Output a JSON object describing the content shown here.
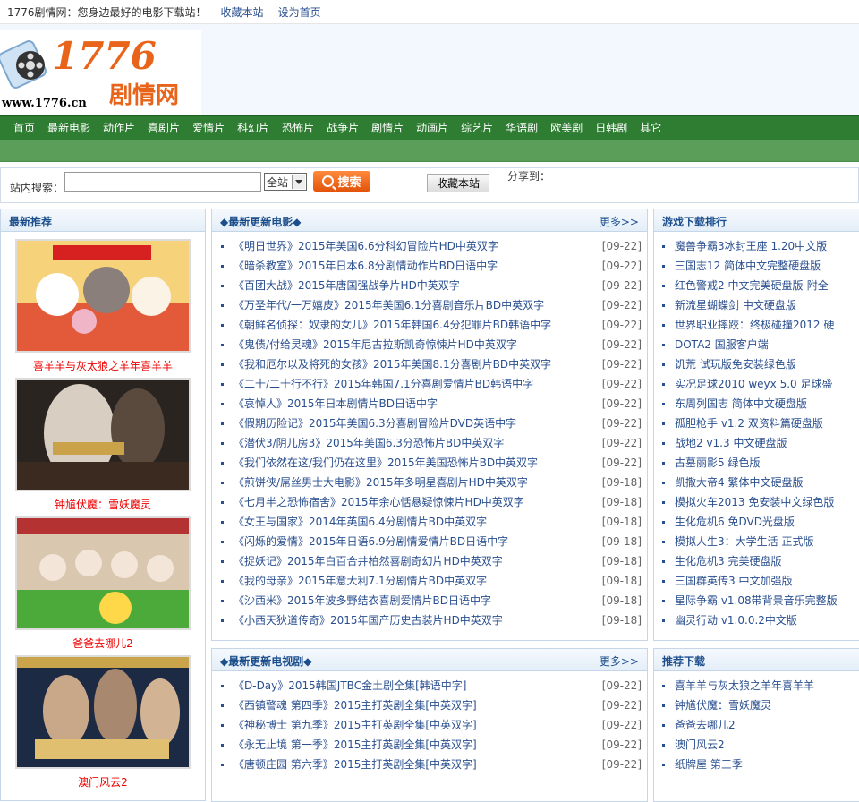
{
  "topbar": {
    "welcome": "1776剧情网：您身边最好的电影下载站！",
    "bookmark": "收藏本站",
    "homepage": "设为首页"
  },
  "logo": {
    "number": "1776",
    "cn": "剧情网",
    "domain": "www.1776.cn"
  },
  "nav": [
    "首页",
    "最新电影",
    "动作片",
    "喜剧片",
    "爱情片",
    "科幻片",
    "恐怖片",
    "战争片",
    "剧情片",
    "动画片",
    "综艺片",
    "华语剧",
    "欧美剧",
    "日韩剧",
    "其它"
  ],
  "search": {
    "label": "站内搜索：",
    "select": "全站",
    "button": "搜索",
    "fav": "收藏本站",
    "share": "分享到："
  },
  "recommend": {
    "title": "最新推荐",
    "items": [
      {
        "caption": "喜羊羊与灰太狼之羊年喜羊羊"
      },
      {
        "caption": "钟馗伏魔：雪妖魔灵"
      },
      {
        "caption": "爸爸去哪儿2"
      },
      {
        "caption": "澳门风云2"
      }
    ]
  },
  "movies": {
    "title": "◆最新更新电影◆",
    "more": "更多>>",
    "items": [
      {
        "t": "《明日世界》2015年美国6.6分科幻冒险片HD中英双字",
        "d": "[09-22]"
      },
      {
        "t": "《暗杀教室》2015年日本6.8分剧情动作片BD日语中字",
        "d": "[09-22]"
      },
      {
        "t": "《百团大战》2015年唐国强战争片HD中英双字",
        "d": "[09-22]"
      },
      {
        "t": "《万圣年代/一万嬉皮》2015年美国6.1分喜剧音乐片BD中英双字",
        "d": "[09-22]"
      },
      {
        "t": "《朝鲜名侦探：奴隶的女儿》2015年韩国6.4分犯罪片BD韩语中字",
        "d": "[09-22]"
      },
      {
        "t": "《鬼债/付给灵魂》2015年尼古拉斯凯奇惊悚片HD中英双字",
        "d": "[09-22]"
      },
      {
        "t": "《我和厄尔以及将死的女孩》2015年美国8.1分喜剧片BD中英双字",
        "d": "[09-22]"
      },
      {
        "t": "《二十/二十行不行》2015年韩国7.1分喜剧爱情片BD韩语中字",
        "d": "[09-22]"
      },
      {
        "t": "《哀悼人》2015年日本剧情片BD日语中字",
        "d": "[09-22]"
      },
      {
        "t": "《假期历险记》2015年美国6.3分喜剧冒险片DVD英语中字",
        "d": "[09-22]"
      },
      {
        "t": "《潜伏3/阴儿房3》2015年美国6.3分恐怖片BD中英双字",
        "d": "[09-22]"
      },
      {
        "t": "《我们依然在这/我们仍在这里》2015年美国恐怖片BD中英双字",
        "d": "[09-22]"
      },
      {
        "t": "《煎饼侠/屌丝男士大电影》2015年多明星喜剧片HD中英双字",
        "d": "[09-18]"
      },
      {
        "t": "《七月半之恐怖宿舍》2015年余心恬悬疑惊悚片HD中英双字",
        "d": "[09-18]"
      },
      {
        "t": "《女王与国家》2014年英国6.4分剧情片BD中英双字",
        "d": "[09-18]"
      },
      {
        "t": "《闪烁的爱情》2015年日语6.9分剧情爱情片BD日语中字",
        "d": "[09-18]"
      },
      {
        "t": "《捉妖记》2015年白百合井柏然喜剧奇幻片HD中英双字",
        "d": "[09-18]"
      },
      {
        "t": "《我的母亲》2015年意大利7.1分剧情片BD中英双字",
        "d": "[09-18]"
      },
      {
        "t": "《沙西米》2015年波多野结衣喜剧爱情片BD日语中字",
        "d": "[09-18]"
      },
      {
        "t": "《小西天狄道传奇》2015年国产历史古装片HD中英双字",
        "d": "[09-18]"
      }
    ]
  },
  "tv": {
    "title": "◆最新更新电视剧◆",
    "more": "更多>>",
    "items": [
      {
        "t": "《D-Day》2015韩国JTBC金土剧全集[韩语中字]",
        "d": "[09-22]"
      },
      {
        "t": "《西镇警魂 第四季》2015主打英剧全集[中英双字]",
        "d": "[09-22]"
      },
      {
        "t": "《神秘博士 第九季》2015主打英剧全集[中英双字]",
        "d": "[09-22]"
      },
      {
        "t": "《永无止境 第一季》2015主打英剧全集[中英双字]",
        "d": "[09-22]"
      },
      {
        "t": "《唐顿庄园 第六季》2015主打英剧全集[中英双字]",
        "d": "[09-22]"
      }
    ]
  },
  "games": {
    "title": "游戏下载排行",
    "items": [
      "魔兽争霸3冰封王座 1.20中文版",
      "三国志12 简体中文完整硬盘版",
      "红色警戒2 中文完美硬盘版-附全",
      "新流星蝴蝶剑 中文硬盘版",
      "世界职业摔跤：终极碰撞2012 硬",
      "DOTA2 国服客户端",
      "饥荒 试玩版免安装绿色版",
      "实况足球2010 weyx 5.0 足球盛",
      "东周列国志 简体中文硬盘版",
      "孤胆枪手 v1.2 双资料篇硬盘版",
      "战地2 v1.3 中文硬盘版",
      "古墓丽影5 绿色版",
      "凯撒大帝4 繁体中文硬盘版",
      "模拟火车2013 免安装中文绿色版",
      "生化危机6 免DVD光盘版",
      "模拟人生3：大学生活 正式版",
      "生化危机3 完美硬盘版",
      "三国群英传3 中文加强版",
      "星际争霸 v1.08带背景音乐完整版",
      "幽灵行动 v1.0.0.2中文版"
    ]
  },
  "recdown": {
    "title": "推荐下载",
    "items": [
      "喜羊羊与灰太狼之羊年喜羊羊",
      "钟馗伏魔：雪妖魔灵",
      "爸爸去哪儿2",
      "澳门风云2",
      "纸牌屋 第三季"
    ]
  }
}
